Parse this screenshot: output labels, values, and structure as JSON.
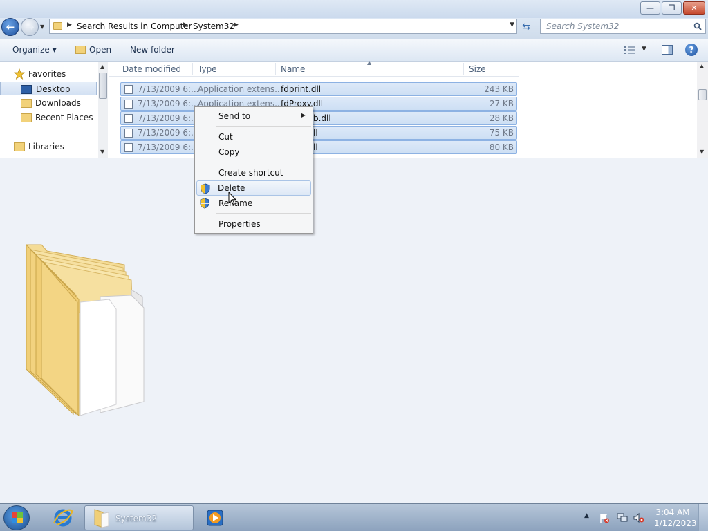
{
  "window": {
    "caption_buttons": {
      "minimize": "—",
      "maximize": "❐",
      "close": "✕"
    },
    "breadcrumb": [
      "Search Results in Computer",
      "System32"
    ],
    "search_placeholder": "Search System32"
  },
  "commandbar": {
    "organize": "Organize ▾",
    "open": "Open",
    "new_folder": "New folder",
    "help": "?"
  },
  "navpane": {
    "items": [
      {
        "label": "Favorites"
      },
      {
        "label": "Desktop"
      },
      {
        "label": "Downloads"
      },
      {
        "label": "Recent Places"
      },
      {
        "label": "Libraries"
      }
    ]
  },
  "filelist": {
    "columns": [
      "Date modified",
      "Type",
      "Name",
      "Size"
    ],
    "rows": [
      {
        "date": "7/13/2009 6:...",
        "type": "Application extens...",
        "name": "fdprint.dll",
        "size": "243 KB"
      },
      {
        "date": "7/13/2009 6:...",
        "type": "Application extens...",
        "name": "fdProxy.dll",
        "size": "27 KB"
      },
      {
        "date": "7/13/2009 6:...",
        "type": "",
        "name": "b.dll",
        "size": "28 KB"
      },
      {
        "date": "7/13/2009 6:...",
        "type": "",
        "name": "ll",
        "size": "75 KB"
      },
      {
        "date": "7/13/2009 6:...",
        "type": "",
        "name": "ll",
        "size": "80 KB"
      }
    ]
  },
  "context_menu": {
    "items": [
      "Send to",
      "Cut",
      "Copy",
      "Create shortcut",
      "Delete",
      "Rename",
      "Properties"
    ],
    "highlighted": "Delete"
  },
  "taskbar": {
    "explorer_label": "System32",
    "time": "3:04 AM",
    "date": "1/12/2023"
  },
  "colors": {
    "selection": "#cddff4",
    "taskbar": "#8ca2bd",
    "desktop": "#eef2f8"
  }
}
